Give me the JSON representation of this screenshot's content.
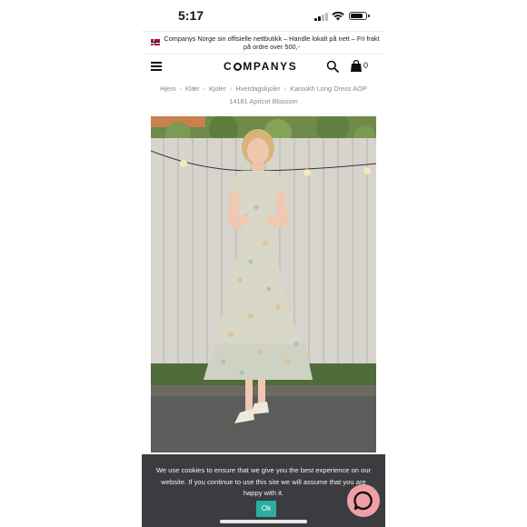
{
  "status_bar": {
    "time": "5:17"
  },
  "announcement": {
    "text": "Companys Norge sin offisielle nettbutikk – Handle lokalt på nett – Fri frakt på ordre over 500,-"
  },
  "header": {
    "logo_text": "C○MPANYS",
    "logo_prefix": "C",
    "logo_suffix": "MPANYS",
    "cart_count": "0"
  },
  "breadcrumb": {
    "items": [
      "Hjem",
      "Klær",
      "Kjoler",
      "Hverdagskjoler"
    ],
    "current": "Karookh Long Dress AOP 14181 Apricot Blossom"
  },
  "cookie_banner": {
    "text": "We use cookies to ensure that we give you the best experience on our website. If you continue to use this site we will assume that you are happy with it.",
    "ok_label": "Ok"
  },
  "colors": {
    "accent": "#2aaea0",
    "banner_bg": "#3b3c40",
    "chat": "#f29ea6"
  }
}
